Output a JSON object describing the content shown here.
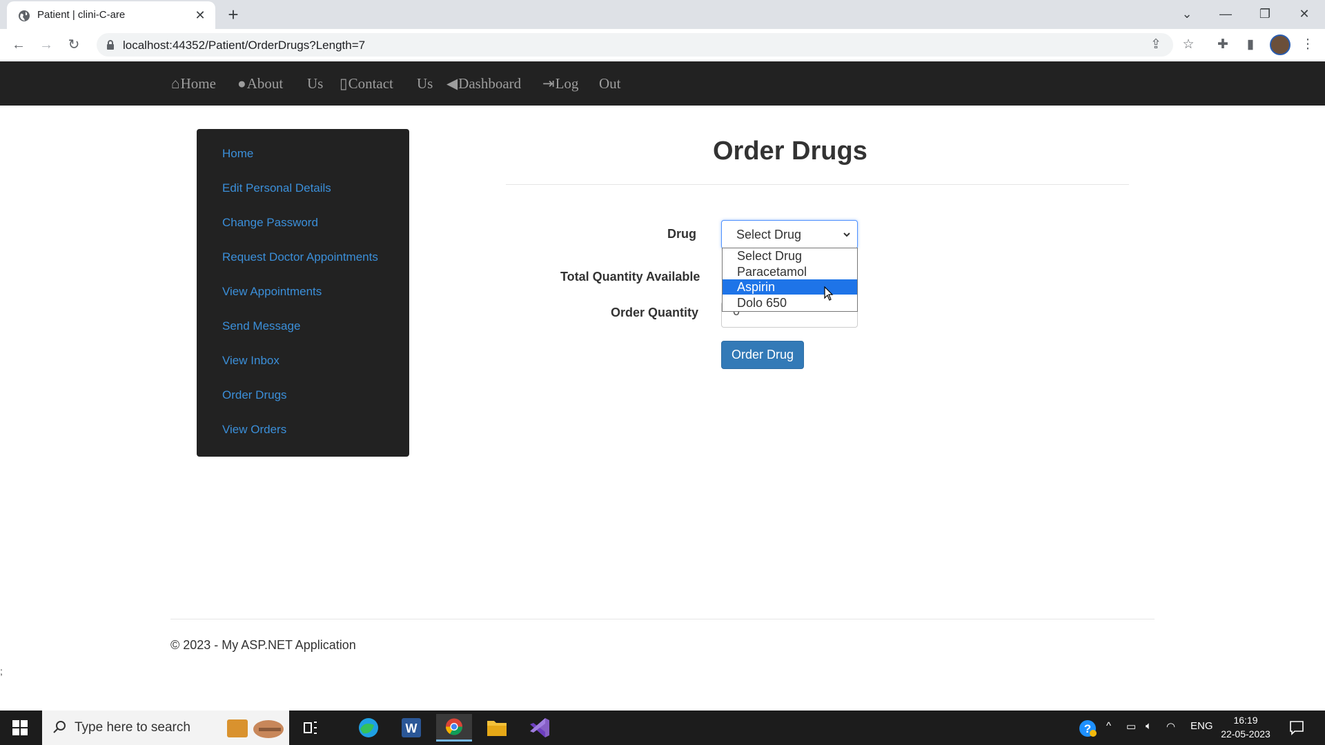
{
  "browser": {
    "tab_title": "Patient | clini-C-are",
    "url": "localhost:44352/Patient/OrderDrugs?Length=7"
  },
  "nav": {
    "items": [
      {
        "label": "Home"
      },
      {
        "label": "About"
      },
      {
        "label": "Us"
      },
      {
        "label": "Contact"
      },
      {
        "label": "Us"
      },
      {
        "label": "Dashboard"
      },
      {
        "label": "Log"
      },
      {
        "label": "Out"
      }
    ]
  },
  "sidebar": {
    "items": [
      {
        "label": "Home"
      },
      {
        "label": "Edit Personal Details"
      },
      {
        "label": "Change Password"
      },
      {
        "label": "Request Doctor Appointments"
      },
      {
        "label": "View Appointments"
      },
      {
        "label": "Send Message"
      },
      {
        "label": "View Inbox"
      },
      {
        "label": "Order Drugs"
      },
      {
        "label": "View Orders"
      }
    ]
  },
  "main": {
    "title": "Order Drugs",
    "form": {
      "drug_label": "Drug",
      "drug_selected": "Select Drug",
      "drug_options": [
        "Select Drug",
        "Paracetamol",
        "Aspirin",
        "Dolo 650"
      ],
      "highlighted_option": "Aspirin",
      "total_qty_label": "Total Quantity Available",
      "order_qty_label": "Order Quantity",
      "order_qty_value": "0",
      "submit_label": "Order Drug"
    }
  },
  "footer": {
    "text": "© 2023 - My ASP.NET Application",
    "stray": ";"
  },
  "taskbar": {
    "search_placeholder": "Type here to search",
    "language": "ENG",
    "time": "16:19",
    "date": "22-05-2023"
  },
  "colors": {
    "navbar_bg": "#222222",
    "sidebar_link": "#3b8fd9",
    "primary_button": "#337ab7",
    "dropdown_highlight": "#1e74e8"
  }
}
